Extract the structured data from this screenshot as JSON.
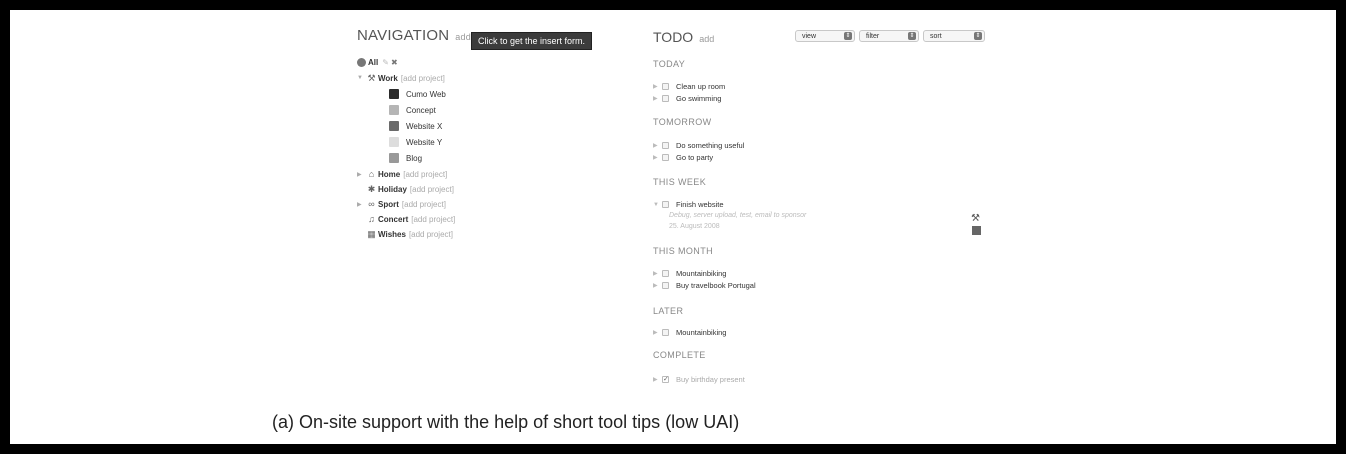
{
  "nav": {
    "title": "NAVIGATION",
    "add_label": "add category",
    "tooltip": "Click to get the insert form.",
    "all_label": "All",
    "items": [
      {
        "label": "Work",
        "sub": "[add project]"
      },
      {
        "label": "Home",
        "sub": "[add project]"
      },
      {
        "label": "Holiday",
        "sub": "[add project]"
      },
      {
        "label": "Sport",
        "sub": "[add project]"
      },
      {
        "label": "Concert",
        "sub": "[add project]"
      },
      {
        "label": "Wishes",
        "sub": "[add project]"
      }
    ],
    "projects": [
      {
        "label": "Cumo Web",
        "color": "#2a2a2a"
      },
      {
        "label": "Concept",
        "color": "#b5b5b5"
      },
      {
        "label": "Website X",
        "color": "#6a6a6a"
      },
      {
        "label": "Website Y",
        "color": "#dddddd"
      },
      {
        "label": "Blog",
        "color": "#999999"
      }
    ]
  },
  "todo": {
    "title": "TODO",
    "add_label": "add",
    "selects": {
      "view": "view",
      "filter": "filter",
      "sort": "sort"
    },
    "sections": [
      {
        "name": "TODAY",
        "tasks": [
          "Clean up room",
          "Go swimming"
        ]
      },
      {
        "name": "TOMORROW",
        "tasks": [
          "Do something useful",
          "Go to party"
        ]
      },
      {
        "name": "THIS WEEK",
        "tasks": [
          "Finish website"
        ]
      },
      {
        "name": "THIS MONTH",
        "tasks": [
          "Mountainbiking",
          "Buy travelbook Portugal"
        ]
      },
      {
        "name": "LATER",
        "tasks": [
          "Mountainbiking"
        ]
      },
      {
        "name": "COMPLETE",
        "tasks": [
          "Buy birthday present"
        ]
      }
    ],
    "expanded_detail": {
      "description": "Debug, server upload, test, email to sponsor",
      "date": "25. August 2008"
    }
  },
  "caption": "(a)  On-site support with the help of short tool tips (low UAI)"
}
